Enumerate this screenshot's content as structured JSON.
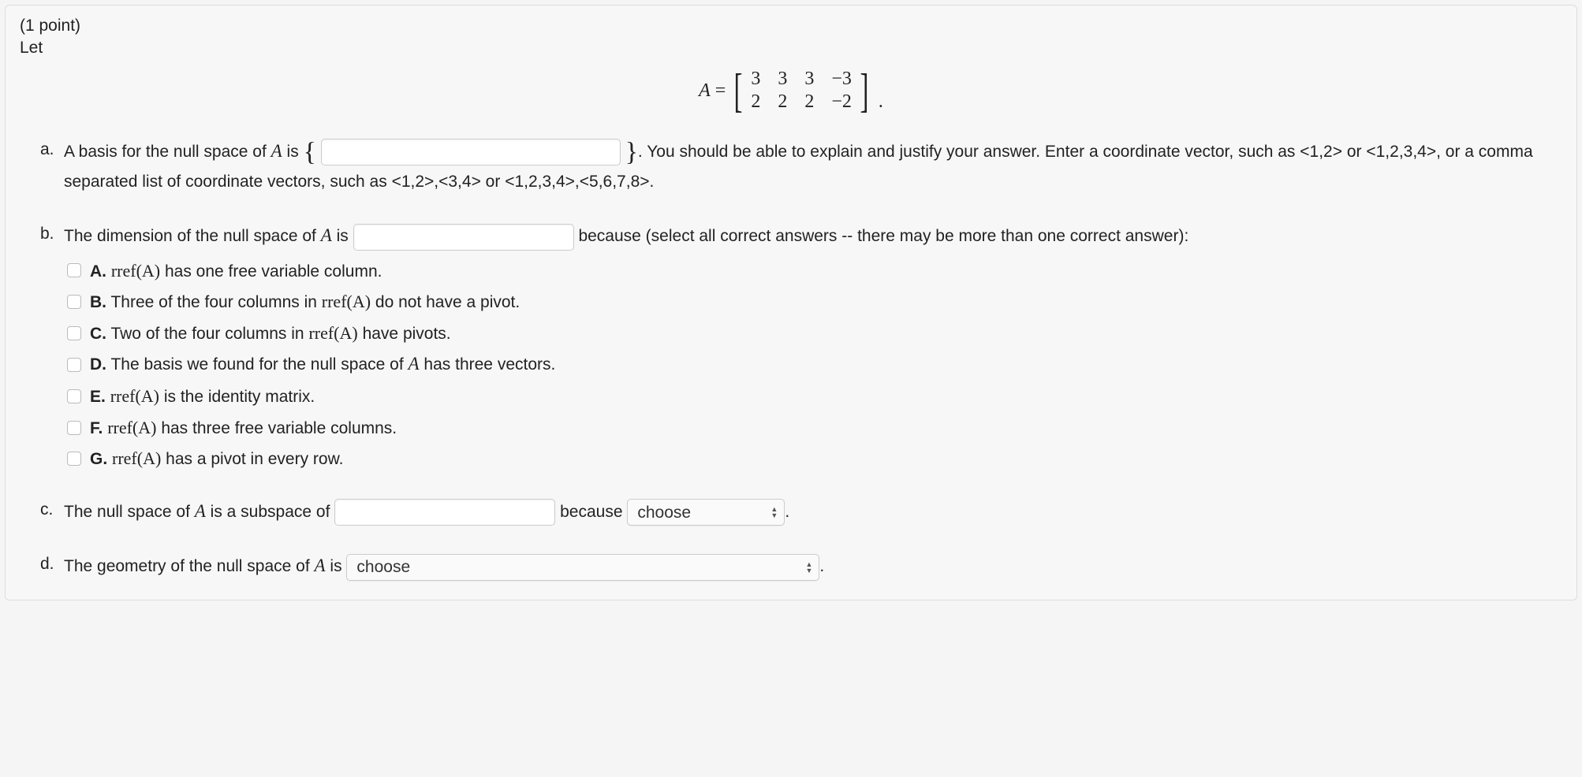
{
  "header": {
    "points": "(1 point)",
    "let": "Let"
  },
  "matrix": {
    "varname": "A",
    "eq": "=",
    "rows": [
      [
        "3",
        "3",
        "3",
        "−3"
      ],
      [
        "2",
        "2",
        "2",
        "−2"
      ]
    ],
    "period": "."
  },
  "parts": {
    "a": {
      "marker": "a.",
      "pre": "A basis for the null space of ",
      "var": "A",
      "mid1": " is ",
      "lbrace": "{",
      "rbrace": "}",
      "post1": ". You should be able to explain and justify your answer. Enter a coordinate vector, such as ",
      "ex1": "<1,2>",
      "or1": " or ",
      "ex2": "<1,2,3,4>",
      "post2": ", or a comma separated list of coordinate vectors, such as ",
      "ex3": "<1,2>,<3,4>",
      "or2": " or ",
      "ex4": "<1,2,3,4>,<5,6,7,8>",
      "end": "."
    },
    "b": {
      "marker": "b.",
      "pre": "The dimension of the null space of ",
      "var": "A",
      "mid1": " is ",
      "post": " because (select all correct answers -- there may be more than one correct answer):",
      "options": [
        {
          "letter": "A.",
          "pre": "",
          "fn": "rref(A)",
          "post": " has one free variable column."
        },
        {
          "letter": "B.",
          "pre": "Three of the four columns in ",
          "fn": "rref(A)",
          "post": " do not have a pivot."
        },
        {
          "letter": "C.",
          "pre": "Two of the four columns in ",
          "fn": "rref(A)",
          "post": " have pivots."
        },
        {
          "letter": "D.",
          "pre": "The basis we found for the null space of ",
          "fn": "A",
          "post": " has three vectors."
        },
        {
          "letter": "E.",
          "pre": "",
          "fn": "rref(A)",
          "post": " is the identity matrix."
        },
        {
          "letter": "F.",
          "pre": "",
          "fn": "rref(A)",
          "post": " has three free variable columns."
        },
        {
          "letter": "G.",
          "pre": "",
          "fn": "rref(A)",
          "post": " has a pivot in every row."
        }
      ]
    },
    "c": {
      "marker": "c.",
      "pre": "The null space of ",
      "var": "A",
      "mid1": " is a subspace of ",
      "because": " because ",
      "select": "choose",
      "end": "."
    },
    "d": {
      "marker": "d.",
      "pre": "The geometry of the null space of ",
      "var": "A",
      "mid1": " is ",
      "select": "choose",
      "end": "."
    }
  }
}
